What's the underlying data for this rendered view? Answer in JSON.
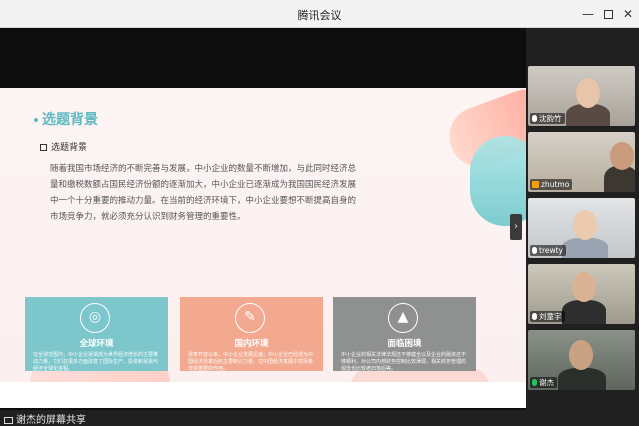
{
  "window": {
    "title": "腾讯会议",
    "minimize": "—",
    "maximize": "",
    "close": "✕"
  },
  "slide": {
    "title": "选题背景",
    "subheading": "选题背景",
    "paragraph": "随着我国市场经济的不断完善与发展，中小企业的数量不断增加，与此同时经济总量和缴税数额占国民经济份额的逐渐加大，中小企业已逐渐成为我国国民经济发展中一个十分重要的推动力量。在当前的经济环境下，中小企业要想不断提高自身的市场竞争力，就必须充分认识到财务管理的重要性。",
    "cards": [
      {
        "title": "全球环境",
        "text": "在全球范围内，中小企业逐渐成为世界经济增长的主要推动力量，它们在很多方面改变了国际生产、投资和贸易与经济全球化进程。",
        "color": "#7dc7cc",
        "icon": "globe-icon"
      },
      {
        "title": "国内环境",
        "text": "改革开放以来，中小企业发展迅速，中小企业已经成为中国经济改革后的主要新兴力量，在中国经济发展中发挥着非常重要的作用。",
        "color": "#f2a98f",
        "icon": "document-icon"
      },
      {
        "title": "面临困境",
        "text": "中小企业的相关法律法规还不够健全以及企业的融资还不够顺利，对公司内部财务控制比较薄弱，相关财务管理的观念也比较老旧落后等。",
        "color": "#8f9090",
        "icon": "mountain-icon"
      }
    ]
  },
  "side_toggle": "›",
  "participants": [
    {
      "name": "沈韵竹",
      "icon": "mic-icon"
    },
    {
      "name": "zhutmo",
      "icon": "user-icon"
    },
    {
      "name": "trewty",
      "icon": "mic-icon"
    },
    {
      "name": "刘童宇",
      "icon": "mic-icon"
    },
    {
      "name": "谢杰",
      "icon": "mic-icon"
    }
  ],
  "bottom": {
    "share_label": "谢杰的屏幕共享"
  }
}
